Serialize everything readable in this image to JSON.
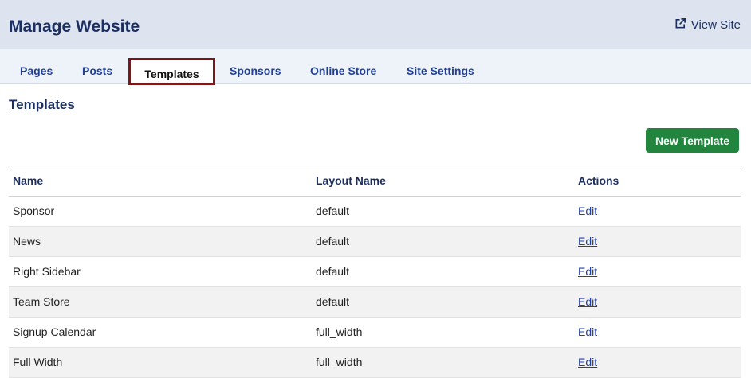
{
  "header": {
    "title": "Manage Website",
    "view_site_label": "View Site",
    "view_site_icon": "external-link-icon"
  },
  "tabs": [
    {
      "label": "Pages"
    },
    {
      "label": "Posts"
    },
    {
      "label": "Templates",
      "active": true
    },
    {
      "label": "Sponsors"
    },
    {
      "label": "Online Store"
    },
    {
      "label": "Site Settings"
    }
  ],
  "main": {
    "section_title": "Templates",
    "new_button_label": "New Template"
  },
  "table": {
    "columns": [
      "Name",
      "Layout Name",
      "Actions"
    ],
    "rows": [
      {
        "name": "Sponsor",
        "layout": "default",
        "action": "Edit"
      },
      {
        "name": "News",
        "layout": "default",
        "action": "Edit"
      },
      {
        "name": "Right Sidebar",
        "layout": "default",
        "action": "Edit"
      },
      {
        "name": "Team Store",
        "layout": "default",
        "action": "Edit"
      },
      {
        "name": "Signup Calendar",
        "layout": "full_width",
        "action": "Edit"
      },
      {
        "name": "Full Width",
        "layout": "full_width",
        "action": "Edit"
      }
    ]
  },
  "colors": {
    "header_bg": "#dde4ef",
    "tab_bar_bg": "#edf3f9",
    "brand_text": "#1b2f62",
    "tab_link": "#1f3f97",
    "active_tab_border": "#7d1616",
    "primary_button": "#21853d"
  }
}
